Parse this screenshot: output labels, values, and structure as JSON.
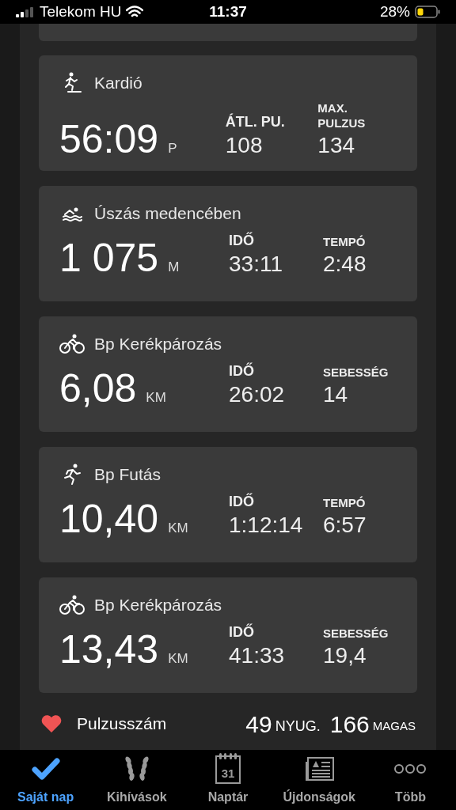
{
  "status_bar": {
    "carrier": "Telekom HU",
    "time": "11:37",
    "battery": "28%"
  },
  "activities": [
    {
      "kind": "cardio",
      "title": "Kardió",
      "value": "56:09",
      "unit": "P",
      "stats": [
        {
          "label": "ÁTL. PU.",
          "value": "108"
        },
        {
          "label": "MAX. PULZUS",
          "value": "134"
        }
      ]
    },
    {
      "kind": "swim",
      "title": "Úszás medencében",
      "value": "1 075",
      "unit": "M",
      "stats": [
        {
          "label": "IDŐ",
          "value": "33:11"
        },
        {
          "label": "TEMPÓ",
          "value": "2:48"
        }
      ]
    },
    {
      "kind": "bike",
      "title": "Bp Kerékpározás",
      "value": "6,08",
      "unit": "KM",
      "stats": [
        {
          "label": "IDŐ",
          "value": "26:02"
        },
        {
          "label": "SEBESSÉG",
          "value": "14"
        }
      ]
    },
    {
      "kind": "run",
      "title": "Bp Futás",
      "value": "10,40",
      "unit": "KM",
      "stats": [
        {
          "label": "IDŐ",
          "value": "1:12:14"
        },
        {
          "label": "TEMPÓ",
          "value": "6:57"
        }
      ]
    },
    {
      "kind": "bike",
      "title": "Bp Kerékpározás",
      "value": "13,43",
      "unit": "KM",
      "stats": [
        {
          "label": "IDŐ",
          "value": "41:33"
        },
        {
          "label": "SEBESSÉG",
          "value": "19,4"
        }
      ]
    }
  ],
  "heart_rate": {
    "label": "Pulzusszám",
    "resting": "49",
    "resting_label": "NYUG.",
    "high": "166",
    "high_label": "MAGAS"
  },
  "tabs": [
    {
      "kind": "check",
      "label": "Saját nap",
      "selected": true
    },
    {
      "kind": "laurel",
      "label": "Kihívások",
      "selected": false
    },
    {
      "kind": "calendar",
      "label": "Naptár",
      "icon_text": "31",
      "selected": false
    },
    {
      "kind": "news",
      "label": "Újdonságok",
      "selected": false
    },
    {
      "kind": "more",
      "label": "Több",
      "selected": false
    }
  ]
}
